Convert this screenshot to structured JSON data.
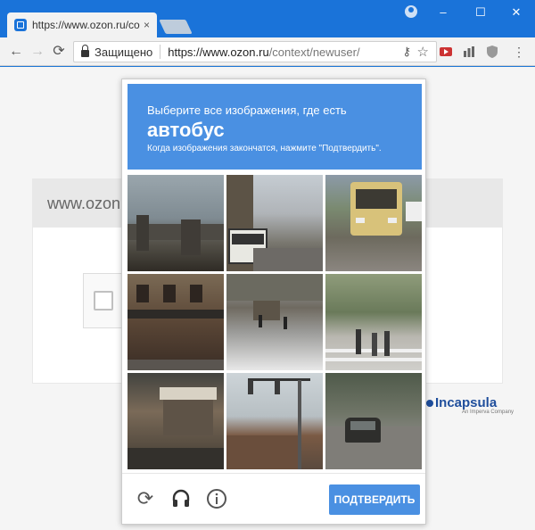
{
  "browser": {
    "tab_title": "https://www.ozon.ru/context",
    "tab_close": "×",
    "secure_label": "Защищено",
    "url_host": "https://www.ozon.ru",
    "url_path": "/context/newuser/",
    "window_controls": {
      "minimize": "–",
      "maximize": "☐",
      "close": "✕"
    }
  },
  "page": {
    "site_header": "www.ozon.",
    "incapsula_logo": "Incapsula",
    "incapsula_sub": "An Imperva Company"
  },
  "captcha": {
    "instruction": "Выберите все изображения, где есть",
    "object": "автобус",
    "note": "Когда изображения закончатся, нажмите \"Подтвердить\".",
    "verify_label": "ПОДТВЕРДИТЬ",
    "tiles": [
      "tile-1",
      "tile-2",
      "tile-3",
      "tile-4",
      "tile-5",
      "tile-6",
      "tile-7",
      "tile-8",
      "tile-9"
    ],
    "colors": {
      "accent": "#4a90e2"
    }
  }
}
